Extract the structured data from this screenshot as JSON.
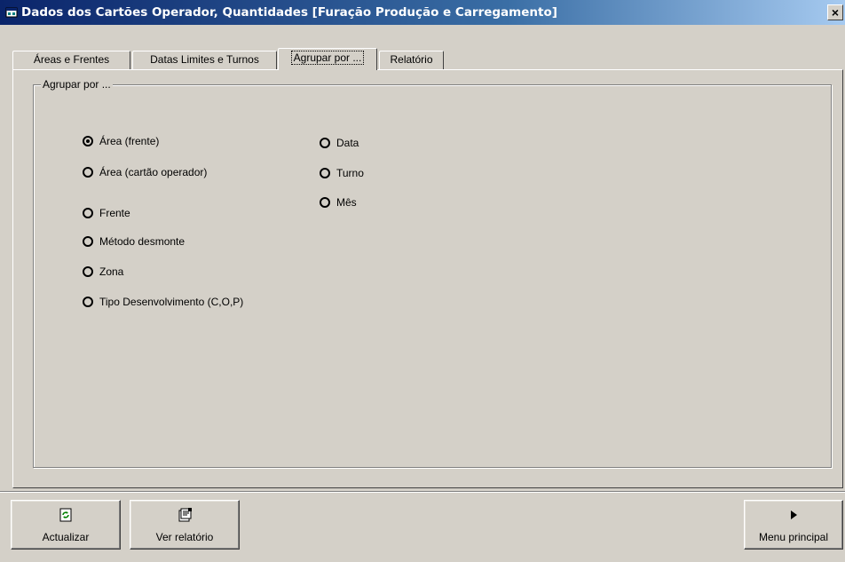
{
  "window": {
    "title": "Dados dos Cartões Operador, Quantidades [Furação Produção e Carregamento]",
    "close_label": "×"
  },
  "tabs": [
    {
      "label": "Áreas e Frentes",
      "active": false
    },
    {
      "label": "Datas Limites e Turnos",
      "active": false
    },
    {
      "label": "Agrupar por ...",
      "active": true
    },
    {
      "label": "Relatório",
      "active": false
    }
  ],
  "group": {
    "legend": "Agrupar por ...",
    "left_options": [
      {
        "label": "Área (frente)",
        "checked": true
      },
      {
        "label": "Área (cartão operador)",
        "checked": false
      },
      {
        "label": "Frente",
        "checked": false
      },
      {
        "label": "Método desmonte",
        "checked": false
      },
      {
        "label": "Zona",
        "checked": false
      },
      {
        "label": "Tipo Desenvolvimento (C,O,P)",
        "checked": false
      }
    ],
    "right_options": [
      {
        "label": "Data",
        "checked": false
      },
      {
        "label": "Turno",
        "checked": false
      },
      {
        "label": "Mês",
        "checked": false
      }
    ]
  },
  "buttons": {
    "refresh": {
      "label": "Actualizar",
      "icon": "refresh-icon"
    },
    "report": {
      "label": "Ver relatório",
      "icon": "report-icon"
    },
    "main_menu": {
      "label": "Menu principal",
      "icon": "play-arrow-icon"
    }
  }
}
